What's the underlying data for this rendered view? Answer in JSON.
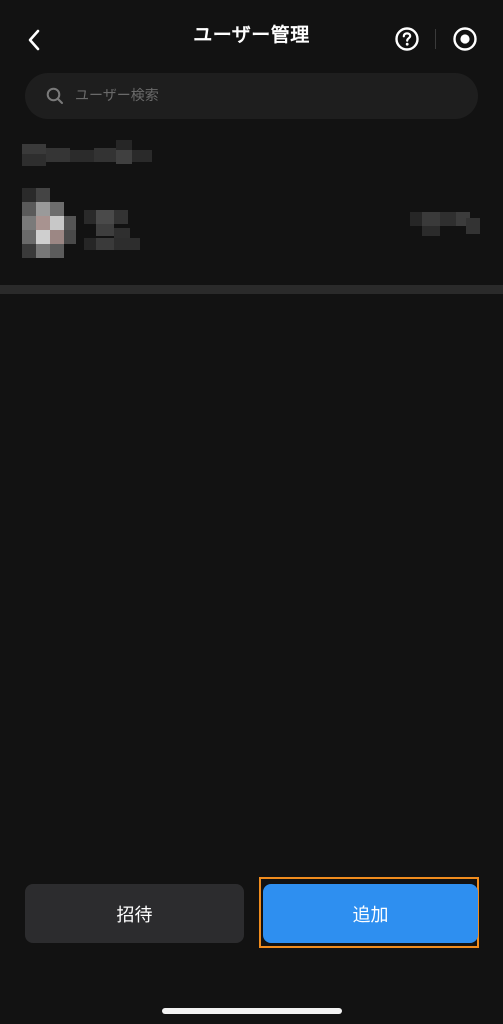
{
  "header": {
    "title": "ユーザー管理",
    "back_icon": "chevron-left-icon",
    "help_icon": "question-circle-icon",
    "settings_icon": "record-circle-icon"
  },
  "search": {
    "placeholder": "ユーザー検索",
    "value": ""
  },
  "users": [
    {
      "name": "",
      "detail": "",
      "redacted": true
    }
  ],
  "footer": {
    "invite_label": "招待",
    "add_label": "追加"
  },
  "colors": {
    "background": "#121212",
    "accent": "#2e8ff0",
    "highlight": "#f08c1e",
    "secondary_button": "#2c2c2e"
  }
}
